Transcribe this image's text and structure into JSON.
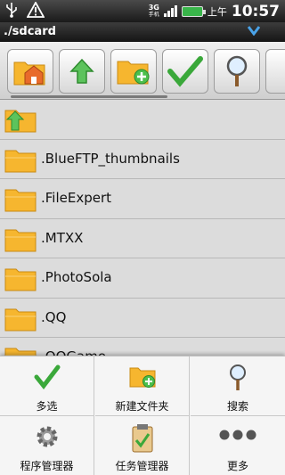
{
  "status_bar": {
    "network": "3G",
    "network_sub": "手机",
    "ampm": "上午",
    "time": "10:57",
    "icons": [
      "usb-icon",
      "warning-icon",
      "signal-icon",
      "battery-icon"
    ]
  },
  "path_bar": {
    "path": "./sdcard",
    "dropdown_icon": "chevron-down-icon"
  },
  "toolbar": {
    "buttons": [
      {
        "name": "home-folder-icon"
      },
      {
        "name": "up-arrow-icon"
      },
      {
        "name": "new-folder-icon"
      },
      {
        "name": "checkmark-icon"
      },
      {
        "name": "search-icon"
      }
    ]
  },
  "files": [
    {
      "name": "",
      "type": "parent"
    },
    {
      "name": ".BlueFTP_thumbnails"
    },
    {
      "name": ".FileExpert"
    },
    {
      "name": ".MTXX"
    },
    {
      "name": ".PhotoSola"
    },
    {
      "name": ".QQ"
    },
    {
      "name": ".QQGame"
    }
  ],
  "menu": {
    "items": [
      {
        "label": "多选",
        "icon": "checkmark-icon"
      },
      {
        "label": "新建文件夹",
        "icon": "new-folder-icon"
      },
      {
        "label": "搜索",
        "icon": "search-icon"
      },
      {
        "label": "程序管理器",
        "icon": "gear-icon"
      },
      {
        "label": "任务管理器",
        "icon": "clipboard-icon"
      },
      {
        "label": "更多",
        "icon": "more-icon"
      }
    ]
  },
  "colors": {
    "folder": "#f6b62f",
    "check": "#3aa83a",
    "accent": "#4aa3e8"
  }
}
